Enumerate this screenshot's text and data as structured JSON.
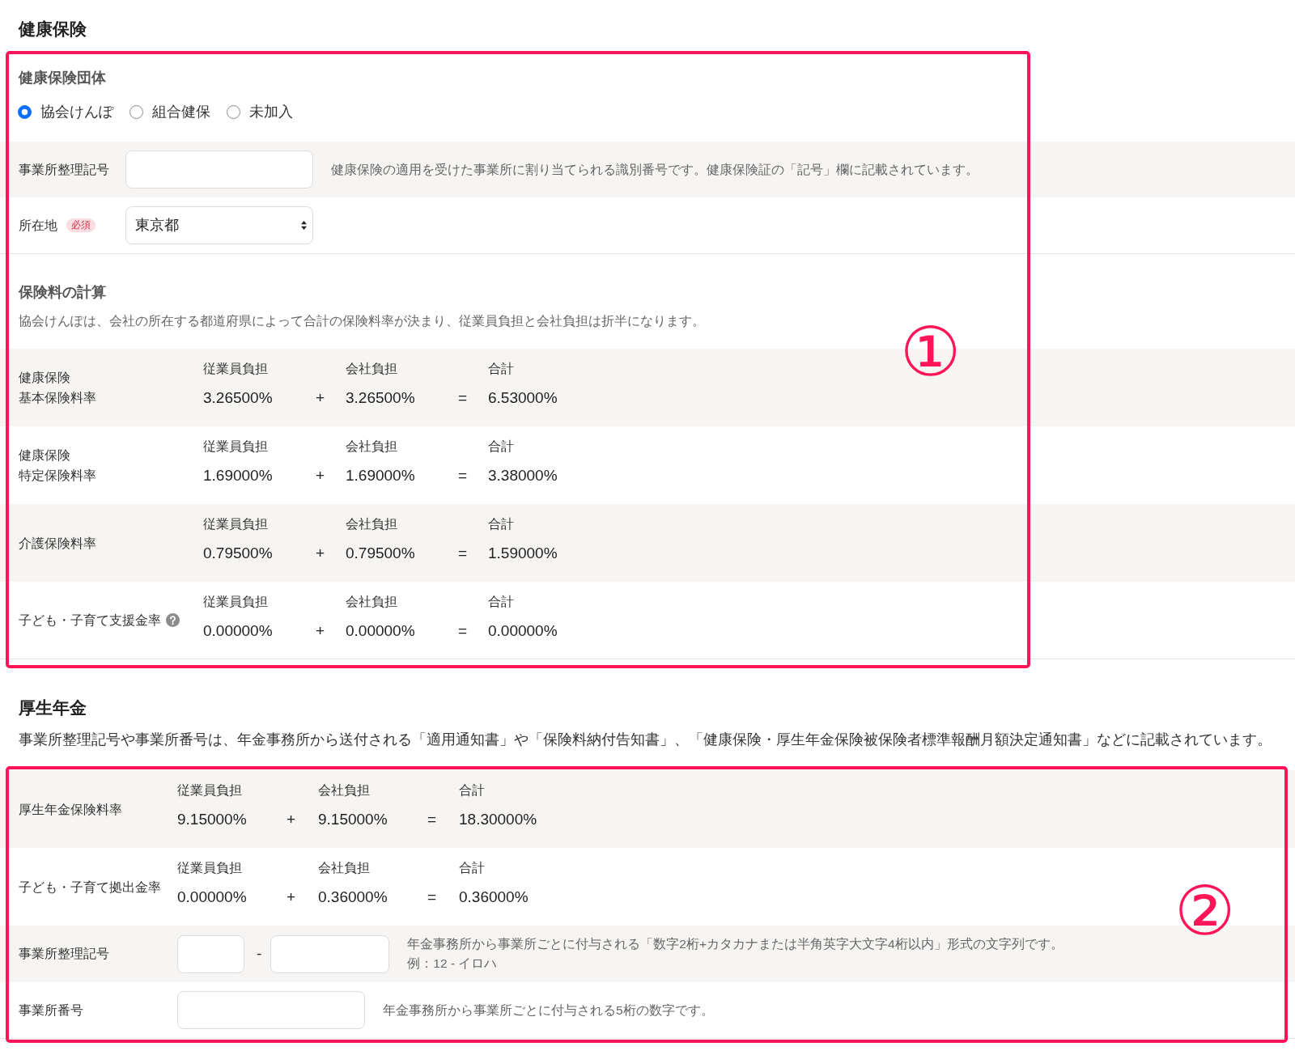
{
  "health_insurance": {
    "title": "健康保険",
    "callout": "①",
    "insurer": {
      "title": "健康保険団体",
      "options": [
        {
          "label": "協会けんぽ",
          "selected": true
        },
        {
          "label": "組合健保",
          "selected": false
        },
        {
          "label": "未加入",
          "selected": false
        }
      ]
    },
    "fields": [
      {
        "kind": "text",
        "label": "事業所整理記号",
        "help": "健康保険の適用を受けた事業所に割り当てられる識別番号です。健康保険証の「記号」欄に記載されています。"
      },
      {
        "kind": "select",
        "label": "所在地",
        "badge": "必須",
        "value": "東京都"
      }
    ],
    "calculation": {
      "title": "保険料の計算",
      "description": "協会けんぽは、会社の所在する都道府県によって合計の保険料率が決まり、従業員負担と会社負担は折半になります。",
      "rates": [
        {
          "label_lines": [
            "健康保険",
            "基本保険料率"
          ],
          "has_help": false,
          "employee_heading": "従業員負担",
          "employee": "3.26500%",
          "plus": "+",
          "company_heading": "会社負担",
          "company": "3.26500%",
          "equals": "=",
          "total_heading": "合計",
          "total": "6.53000%"
        },
        {
          "label_lines": [
            "健康保険",
            "特定保険料率"
          ],
          "has_help": false,
          "employee_heading": "従業員負担",
          "employee": "1.69000%",
          "plus": "+",
          "company_heading": "会社負担",
          "company": "1.69000%",
          "equals": "=",
          "total_heading": "合計",
          "total": "3.38000%"
        },
        {
          "label_lines": [
            "介護保険料率"
          ],
          "has_help": false,
          "employee_heading": "従業員負担",
          "employee": "0.79500%",
          "plus": "+",
          "company_heading": "会社負担",
          "company": "0.79500%",
          "equals": "=",
          "total_heading": "合計",
          "total": "1.59000%"
        },
        {
          "label_lines": [
            "子ども・子育て支援金率"
          ],
          "has_help": true,
          "employee_heading": "従業員負担",
          "employee": "0.00000%",
          "plus": "+",
          "company_heading": "会社負担",
          "company": "0.00000%",
          "equals": "=",
          "total_heading": "合計",
          "total": "0.00000%"
        }
      ]
    }
  },
  "welfare_pension": {
    "title": "厚生年金",
    "description": "事業所整理記号や事業所番号は、年金事務所から送付される「適用通知書」や「保険料納付告知書」、「健康保険・厚生年金保険被保険者標準報酬月額決定通知書」などに記載されています。",
    "callout": "②",
    "rates": [
      {
        "label_lines": [
          "厚生年金保険料率"
        ],
        "has_help": false,
        "employee_heading": "従業員負担",
        "employee": "9.15000%",
        "plus": "+",
        "company_heading": "会社負担",
        "company": "9.15000%",
        "equals": "=",
        "total_heading": "合計",
        "total": "18.30000%"
      },
      {
        "label_lines": [
          "子ども・子育て拠出金率"
        ],
        "has_help": false,
        "employee_heading": "従業員負担",
        "employee": "0.00000%",
        "plus": "+",
        "company_heading": "会社負担",
        "company": "0.36000%",
        "equals": "=",
        "total_heading": "合計",
        "total": "0.36000%"
      }
    ],
    "fields": [
      {
        "kind": "split",
        "label": "事業所整理記号",
        "separator": "-",
        "help": "年金事務所から事業所ごとに付与される「数字2桁+カタカナまたは半角英字大文字4桁以内」形式の文字列です。",
        "example": "例：12 - イロハ"
      },
      {
        "kind": "text",
        "label": "事業所番号",
        "help": "年金事務所から事業所ごとに付与される5桁の数字です。"
      }
    ]
  }
}
